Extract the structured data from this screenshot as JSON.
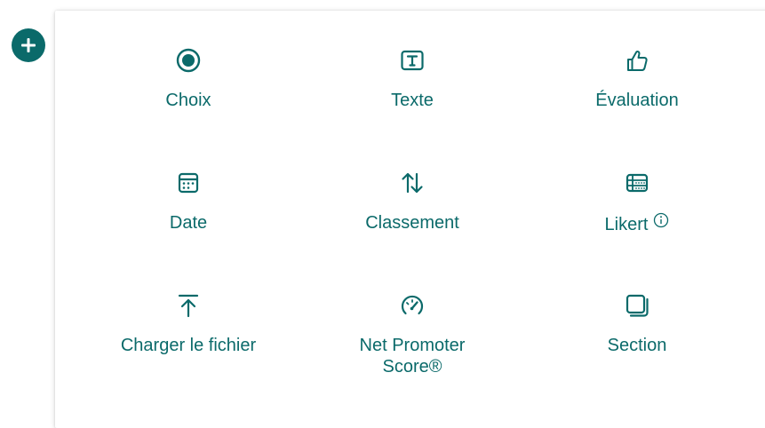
{
  "add_button": {
    "icon": "plus-icon",
    "color": "#0b6a6a"
  },
  "accent_color": "#0b6a6a",
  "items": [
    {
      "key": "choice",
      "label": "Choix",
      "icon": "radio-button-icon"
    },
    {
      "key": "text",
      "label": "Texte",
      "icon": "text-box-icon"
    },
    {
      "key": "rating",
      "label": "Évaluation",
      "icon": "thumbs-up-icon"
    },
    {
      "key": "date",
      "label": "Date",
      "icon": "calendar-icon"
    },
    {
      "key": "ranking",
      "label": "Classement",
      "icon": "sort-arrows-icon"
    },
    {
      "key": "likert",
      "label": "Likert",
      "icon": "likert-grid-icon",
      "info_icon": "info-icon"
    },
    {
      "key": "upload",
      "label": "Charger le fichier",
      "icon": "upload-icon"
    },
    {
      "key": "nps",
      "label": "Net Promoter Score®",
      "icon": "gauge-icon"
    },
    {
      "key": "section",
      "label": "Section",
      "icon": "section-icon"
    }
  ]
}
